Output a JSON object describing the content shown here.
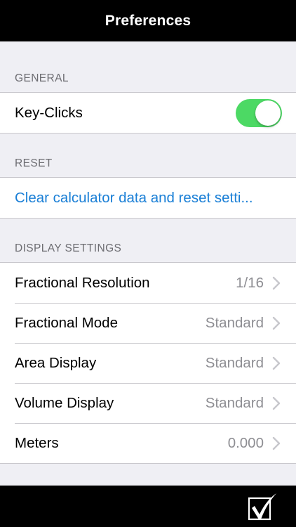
{
  "nav": {
    "title": "Preferences"
  },
  "sections": {
    "general": {
      "header": "GENERAL",
      "key_clicks": {
        "label": "Key-Clicks",
        "on": true
      }
    },
    "reset": {
      "header": "RESET",
      "clear_link": "Clear calculator data and reset setti..."
    },
    "display": {
      "header": "DISPLAY SETTINGS",
      "items": [
        {
          "label": "Fractional Resolution",
          "value": "1/16"
        },
        {
          "label": "Fractional Mode",
          "value": "Standard"
        },
        {
          "label": "Area Display",
          "value": "Standard"
        },
        {
          "label": "Volume Display",
          "value": "Standard"
        },
        {
          "label": "Meters",
          "value": "0.000"
        }
      ]
    }
  },
  "toolbar": {
    "done_icon": "checkbox-check-icon"
  },
  "colors": {
    "accent": "#1a7fd6",
    "toggle_on": "#4cd964",
    "background": "#efeff4",
    "bar": "#000000"
  }
}
